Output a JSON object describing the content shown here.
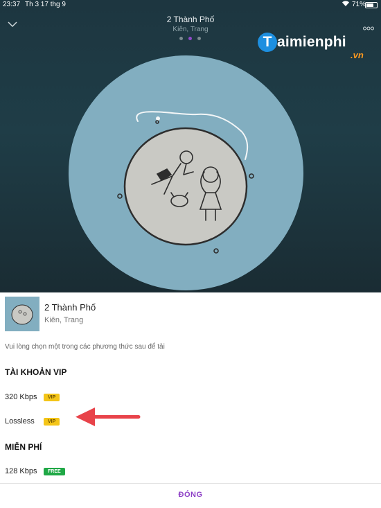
{
  "status_bar": {
    "time": "23:37",
    "date": "Th 3 17 thg 9",
    "battery": "71%"
  },
  "player": {
    "title": "2 Thành Phố",
    "artist": "Kiên, Trang",
    "colors": {
      "background": "#1f3d47",
      "disc": "#82aec0",
      "active_dot": "#8f4bc9"
    }
  },
  "watermark": {
    "letter": "T",
    "name": "aimienphi",
    "suffix": ".vn"
  },
  "sheet": {
    "song_title": "2 Thành Phố",
    "song_artist": "Kiên, Trang",
    "prompt": "Vui lòng chọn một trong các phương thức sau để tải",
    "vip_section": {
      "title": "TÀI KHOẢN VIP",
      "options": [
        {
          "label": "320 Kbps",
          "badge": "VIP"
        },
        {
          "label": "Lossless",
          "badge": "VIP"
        }
      ]
    },
    "free_section": {
      "title": "MIỄN PHÍ",
      "options": [
        {
          "label": "128 Kbps",
          "badge": "FREE"
        }
      ]
    },
    "close_label": "ĐÓNG",
    "colors": {
      "vip_badge": "#f4c518",
      "free_badge": "#20a846",
      "close": "#8d3fc6",
      "arrow": "#e8434a"
    }
  }
}
